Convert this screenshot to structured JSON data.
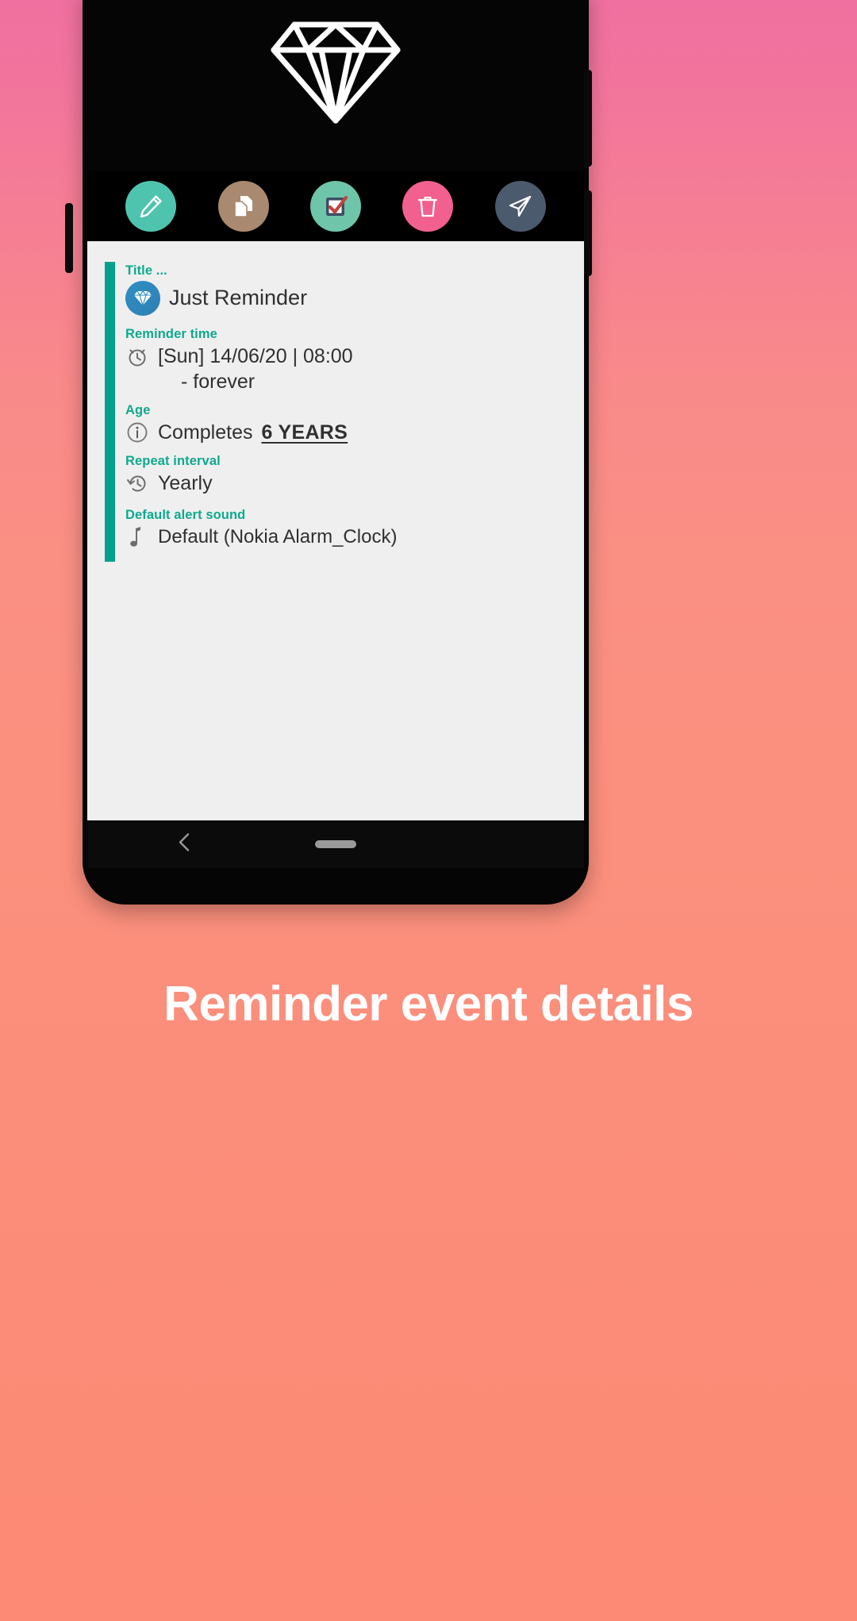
{
  "caption": "Reminder event details",
  "phone": {
    "hero": {
      "logo_icon": "diamond-icon"
    },
    "action_bar": {
      "buttons": [
        {
          "name": "edit-button",
          "icon": "pencil-icon",
          "color": "#4ec4ae"
        },
        {
          "name": "duplicate-button",
          "icon": "copy-icon",
          "color": "#a98a70"
        },
        {
          "name": "complete-button",
          "icon": "checkbox-icon",
          "color": "#6ec5a9"
        },
        {
          "name": "delete-button",
          "icon": "trash-icon",
          "color": "#f2608f"
        },
        {
          "name": "share-button",
          "icon": "send-icon",
          "color": "#4c5a6e"
        }
      ]
    },
    "details": {
      "accent_color": "#05a08b",
      "fields": [
        {
          "label": "Title ...",
          "value": "Just Reminder",
          "icon": "diamond-avatar-icon"
        },
        {
          "label": "Reminder time",
          "value": "[Sun] 14/06/20 | 08:00",
          "sub_value": "-  forever",
          "icon": "alarm-clock-icon"
        },
        {
          "label": "Age",
          "value_prefix": "Completes ",
          "value_emphasis": "6 YEARS",
          "icon": "info-icon"
        },
        {
          "label": "Repeat interval",
          "value": "Yearly",
          "icon": "history-icon"
        },
        {
          "label": "Default alert sound",
          "value": "Default (Nokia Alarm_Clock)",
          "icon": "music-note-icon"
        }
      ]
    },
    "nav": {
      "back_icon": "chevron-left-icon",
      "home_pill": "home-indicator"
    }
  }
}
